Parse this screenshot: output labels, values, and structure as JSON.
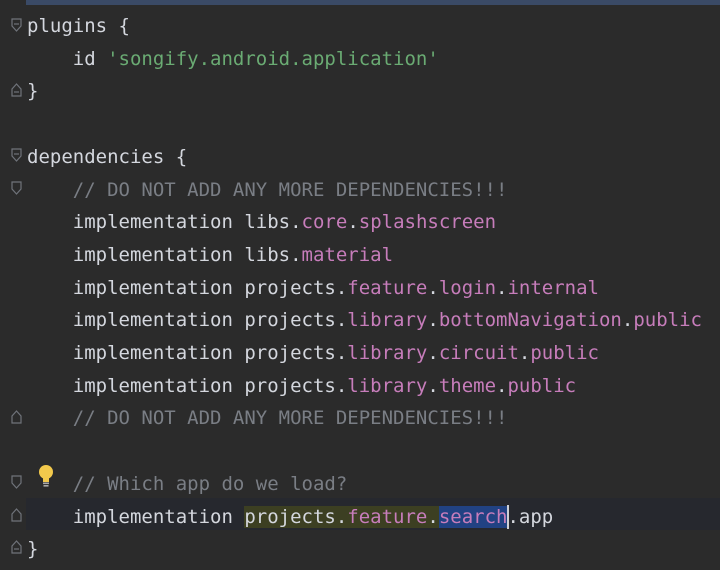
{
  "editor": {
    "lines": [
      {
        "id": "l1",
        "parts": [
          [
            "brace",
            "plugins {"
          ]
        ]
      },
      {
        "id": "l2",
        "parts": [
          [
            "kw",
            "    id "
          ],
          [
            "str",
            "'songify.android.application'"
          ]
        ]
      },
      {
        "id": "l3",
        "parts": [
          [
            "brace",
            "}"
          ]
        ]
      },
      {
        "id": "l4",
        "parts": []
      },
      {
        "id": "l5",
        "parts": [
          [
            "brace",
            "dependencies {"
          ]
        ]
      },
      {
        "id": "l6",
        "parts": [
          [
            "com",
            "    // DO NOT ADD ANY MORE DEPENDENCIES!!!"
          ]
        ]
      },
      {
        "id": "l7",
        "parts": [
          [
            "kw",
            "    implementation libs."
          ],
          [
            "prop",
            "core"
          ],
          [
            "kw",
            "."
          ],
          [
            "prop",
            "splashscreen"
          ]
        ]
      },
      {
        "id": "l8",
        "parts": [
          [
            "kw",
            "    implementation libs."
          ],
          [
            "prop",
            "material"
          ]
        ]
      },
      {
        "id": "l9",
        "parts": [
          [
            "kw",
            "    implementation projects."
          ],
          [
            "prop",
            "feature"
          ],
          [
            "kw",
            "."
          ],
          [
            "prop",
            "login"
          ],
          [
            "kw",
            "."
          ],
          [
            "prop",
            "internal"
          ]
        ]
      },
      {
        "id": "l10",
        "parts": [
          [
            "kw",
            "    implementation projects."
          ],
          [
            "prop",
            "library"
          ],
          [
            "kw",
            "."
          ],
          [
            "prop",
            "bottomNavigation"
          ],
          [
            "kw",
            "."
          ],
          [
            "prop",
            "public"
          ]
        ]
      },
      {
        "id": "l11",
        "parts": [
          [
            "kw",
            "    implementation projects."
          ],
          [
            "prop",
            "library"
          ],
          [
            "kw",
            "."
          ],
          [
            "prop",
            "circuit"
          ],
          [
            "kw",
            "."
          ],
          [
            "prop",
            "public"
          ]
        ]
      },
      {
        "id": "l12",
        "parts": [
          [
            "kw",
            "    implementation projects."
          ],
          [
            "prop",
            "library"
          ],
          [
            "kw",
            "."
          ],
          [
            "prop",
            "theme"
          ],
          [
            "kw",
            "."
          ],
          [
            "prop",
            "public"
          ]
        ]
      },
      {
        "id": "l13",
        "parts": [
          [
            "com",
            "    // DO NOT ADD ANY MORE DEPENDENCIES!!!"
          ]
        ]
      },
      {
        "id": "l14",
        "parts": []
      },
      {
        "id": "l15",
        "parts": [
          [
            "com",
            "    // Which app do we load?"
          ]
        ]
      },
      {
        "id": "l16",
        "parts": [
          [
            "kw",
            "    implementation "
          ],
          [
            "kw hl-read",
            "projects."
          ],
          [
            "prop hl-read",
            "feature"
          ],
          [
            "kw hl-read",
            "."
          ],
          [
            "prop hl-sel",
            "search"
          ],
          [
            "caret",
            ""
          ],
          [
            "kw",
            ".app"
          ]
        ]
      },
      {
        "id": "l17",
        "parts": [
          [
            "brace",
            "}"
          ]
        ]
      }
    ]
  },
  "icons": {
    "fold": "fold-marker-icon",
    "intention": "lightbulb-icon"
  },
  "colors": {
    "background": "#2b2b2b",
    "text": "#d4d7de",
    "string": "#6aab73",
    "property": "#c77dbb",
    "comment": "#7a7e85",
    "selection": "#214283",
    "read_highlight": "#3c3f22"
  }
}
